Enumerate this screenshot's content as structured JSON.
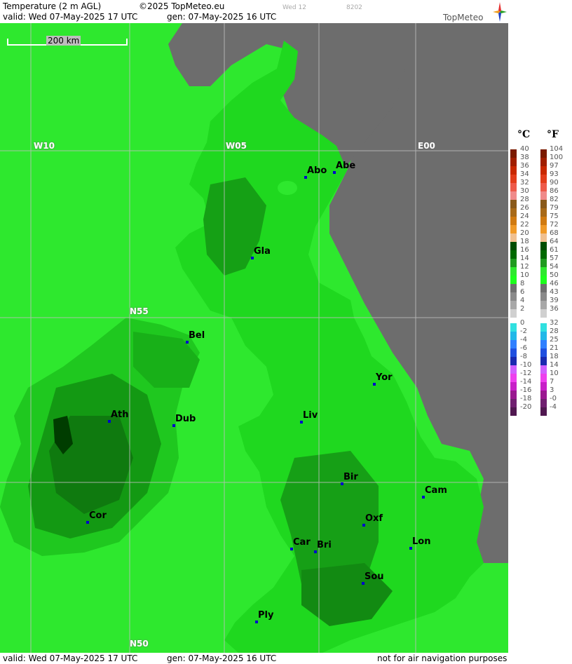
{
  "header": {
    "title": "Temperature (2 m AGL)",
    "copyright": "©2025 TopMeteo.eu",
    "faint_day": "Wed 12",
    "faint_code": "8202",
    "valid": "valid:  Wed  07-May-2025  17 UTC",
    "gen": "gen: 07-May-2025 16 UTC",
    "brand": "TopMeteo"
  },
  "footer": {
    "valid": "valid:  Wed  07-May-2025  17 UTC",
    "gen": "gen: 07-May-2025 16 UTC",
    "disclaimer": "not for air navigation purposes"
  },
  "map": {
    "scale_label": "200 km",
    "grid_labels": {
      "w10": "W10",
      "w05": "W05",
      "e00": "E00",
      "n55": "N55",
      "n50": "N50"
    },
    "cities": [
      {
        "label": "Abo"
      },
      {
        "label": "Abe"
      },
      {
        "label": "Gla"
      },
      {
        "label": "Bel"
      },
      {
        "label": "Yor"
      },
      {
        "label": "Ath"
      },
      {
        "label": "Dub"
      },
      {
        "label": "Liv"
      },
      {
        "label": "Bir"
      },
      {
        "label": "Cam"
      },
      {
        "label": "Cor"
      },
      {
        "label": "Oxf"
      },
      {
        "label": "Car"
      },
      {
        "label": "Bri"
      },
      {
        "label": "Lon"
      },
      {
        "label": "Sou"
      },
      {
        "label": "Ply"
      }
    ]
  },
  "legend": {
    "unit_c": "°C",
    "unit_f": "°F",
    "celsius": [
      "40",
      "38",
      "36",
      "34",
      "32",
      "30",
      "28",
      "26",
      "24",
      "22",
      "20",
      "18",
      "16",
      "14",
      "12",
      "10",
      "8",
      "6",
      "4",
      "2",
      "0",
      "-2",
      "-4",
      "-6",
      "-8",
      "-10",
      "-12",
      "-14",
      "-16",
      "-18",
      "-20"
    ],
    "fahrenheit": [
      "104",
      "100",
      "97",
      "93",
      "90",
      "86",
      "82",
      "79",
      "75",
      "72",
      "68",
      "64",
      "61",
      "57",
      "54",
      "50",
      "46",
      "43",
      "39",
      "36",
      "32",
      "28",
      "25",
      "21",
      "18",
      "14",
      "10",
      "7",
      "3",
      "-0",
      "-4"
    ],
    "colors": [
      "#7a1a00",
      "#a01e00",
      "#c82800",
      "#e23c1a",
      "#ee5a4a",
      "#f08a8a",
      "#8a5a1a",
      "#a86a18",
      "#d07a10",
      "#f09a28",
      "#f0c090",
      "#004d00",
      "#006a00",
      "#1f9a1f",
      "#2ee82e",
      "#1cff1c",
      "#6f6f6f",
      "#8a8a8a",
      "#a8a8a8",
      "#d0d0d0",
      "#30e0e0",
      "#20b8e8",
      "#3080ff",
      "#2050e0",
      "#1a2ab0",
      "#d060ff",
      "#ee40ee",
      "#c820c8",
      "#9a1890",
      "#702070",
      "#501850"
    ]
  }
}
